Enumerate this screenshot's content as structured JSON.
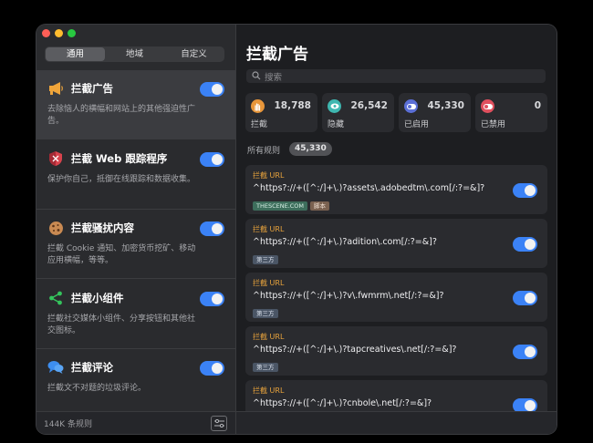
{
  "sidebar": {
    "tabs": [
      {
        "label": "通用",
        "active": true
      },
      {
        "label": "地域",
        "active": false
      },
      {
        "label": "自定义",
        "active": false
      }
    ],
    "items": [
      {
        "title": "拦截广告",
        "desc": "去除恼人的横幅和网站上的其他强迫性广告。",
        "enabled": true
      },
      {
        "title": "拦截 Web 跟踪程序",
        "desc": "保护你自己，抵御在线跟踪和数据收集。",
        "enabled": true
      },
      {
        "title": "拦截骚扰内容",
        "desc": "拦截 Cookie 通知、加密货币挖矿、移动应用横幅，等等。",
        "enabled": true
      },
      {
        "title": "拦截小组件",
        "desc": "拦截社交媒体小组件、分享按钮和其他社交图标。",
        "enabled": true
      },
      {
        "title": "拦截评论",
        "desc": "拦截文不对题的垃圾评论。",
        "enabled": true
      }
    ],
    "footer_count": "144K 条规则"
  },
  "main": {
    "title": "拦截广告",
    "search_placeholder": "搜索",
    "stats": [
      {
        "label": "拦截",
        "value": "18,788",
        "color": "#e8963a"
      },
      {
        "label": "隐藏",
        "value": "26,542",
        "color": "#3fb7b0"
      },
      {
        "label": "已启用",
        "value": "45,330",
        "color": "#5b6fd6"
      },
      {
        "label": "已禁用",
        "value": "0",
        "color": "#e0505e"
      }
    ],
    "rules_heading": "所有规则",
    "rules_count": "45,330",
    "rules": [
      {
        "type": "拦截 URL",
        "pattern": "^https?://+([^:/]+\\.)?assets\\.adobedtm\\.com[/:?=&]?",
        "tags": [
          {
            "text": "THESCENE.COM",
            "kind": "domain"
          },
          {
            "text": "脚本",
            "kind": "script"
          }
        ],
        "enabled": true
      },
      {
        "type": "拦截 URL",
        "pattern": "^https?://+([^:/]+\\.)?adition\\.com[/:?=&]?",
        "tags": [
          {
            "text": "第三方",
            "kind": "third"
          }
        ],
        "enabled": true
      },
      {
        "type": "拦截 URL",
        "pattern": "^https?://+([^:/]+\\.)?v\\.fwmrm\\.net[/:?=&]?",
        "tags": [
          {
            "text": "第三方",
            "kind": "third"
          }
        ],
        "enabled": true
      },
      {
        "type": "拦截 URL",
        "pattern": "^https?://+([^:/]+\\.)?tapcreatives\\.net[/:?=&]?",
        "tags": [
          {
            "text": "第三方",
            "kind": "third"
          }
        ],
        "enabled": true
      },
      {
        "type": "拦截 URL",
        "pattern": "^https?://+([^:/]+\\.)?cnbole\\.net[/:?=&]?",
        "tags": [],
        "enabled": true
      }
    ]
  },
  "colors": {
    "accent": "#3b82f6",
    "rule_type": "#e8a33c"
  }
}
